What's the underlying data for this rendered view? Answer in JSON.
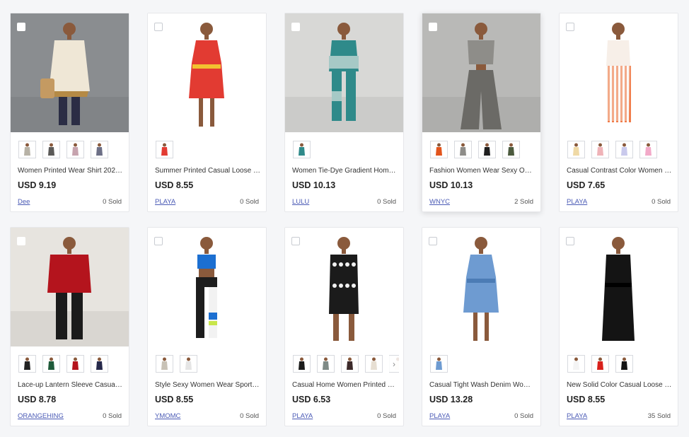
{
  "products": [
    {
      "title": "Women Printed Wear Shirt 202…",
      "price": "USD 9.19",
      "seller": "Dee",
      "sold": "0 Sold",
      "bg": "#8a8d90",
      "garment": "#efe7d6",
      "accent": "#b58a45",
      "style": "top",
      "thumbs": [
        "#b7b2a6",
        "#5b5a58",
        "#c6a3ae",
        "#6c6f86"
      ]
    },
    {
      "title": "Summer Printed Casual Loose …",
      "price": "USD 8.55",
      "seller": "PLAYA",
      "sold": "0 Sold",
      "bg": "#ffffff",
      "garment": "#e23b32",
      "accent": "#f2c230",
      "style": "dress",
      "thumbs": [
        "#e23b32"
      ]
    },
    {
      "title": "Women Tie-Dye Gradient Hom…",
      "price": "USD 10.13",
      "seller": "LULU",
      "sold": "0 Sold",
      "bg": "#d8d8d6",
      "garment": "#2f8a8a",
      "accent": "#a6c9c6",
      "style": "set",
      "thumbs": [
        "#2f8a8a"
      ]
    },
    {
      "title": "Fashion Women Wear Sexy One…",
      "price": "USD 10.13",
      "seller": "WNYC",
      "sold": "2 Sold",
      "bg": "#b9b9b7",
      "garment": "#8e8d89",
      "accent": "#6b6a66",
      "style": "wide",
      "thumbs": [
        "#e2541c",
        "#8e8d89",
        "#1f1f1f",
        "#4b5a3e"
      ]
    },
    {
      "title": "Casual Contrast Color Women …",
      "price": "USD 7.65",
      "seller": "PLAYA",
      "sold": "0 Sold",
      "bg": "#ffffff",
      "garment": "#f7efe8",
      "accent": "#f07c4a",
      "style": "striped",
      "thumbs": [
        "#efd9a5",
        "#efb3b8",
        "#c9c9ec",
        "#f2a9c8"
      ]
    },
    {
      "title": "Lace-up Lantern Sleeve Casual …",
      "price": "USD 8.78",
      "seller": "ORANGEHING",
      "sold": "0 Sold",
      "bg": "#e7e4df",
      "garment": "#b4141d",
      "accent": "#1b1b1b",
      "style": "top-pants",
      "thumbs": [
        "#222222",
        "#1f5a3a",
        "#b4141d",
        "#25284a"
      ]
    },
    {
      "title": "Style Sexy Women Wear Sports …",
      "price": "USD 8.55",
      "seller": "YMOMC",
      "sold": "0 Sold",
      "bg": "#ffffff",
      "garment": "#1d1d1d",
      "accent": "#1c6fd1",
      "style": "sport",
      "thumbs": [
        "#c8c2b6",
        "#e5e5e5"
      ]
    },
    {
      "title": "Casual Home Women Printed …",
      "price": "USD 6.53",
      "seller": "PLAYA",
      "sold": "0 Sold",
      "bg": "#ffffff",
      "garment": "#1b1b1b",
      "accent": "#f0f0f0",
      "style": "romper",
      "thumbs": [
        "#1b1b1b",
        "#7e8a86",
        "#3c2a2a",
        "#e7dfd3",
        "#f5ede0"
      ]
    },
    {
      "title": "Casual Tight Wash Denim Wom…",
      "price": "USD 13.28",
      "seller": "PLAYA",
      "sold": "0 Sold",
      "bg": "#ffffff",
      "garment": "#6e9bd1",
      "accent": "#4c7cb5",
      "style": "dress",
      "thumbs": [
        "#6e9bd1"
      ]
    },
    {
      "title": "New Solid Color Casual Loose …",
      "price": "USD 8.55",
      "seller": "PLAYA",
      "sold": "35 Sold",
      "bg": "#ffffff",
      "garment": "#141414",
      "accent": "#141414",
      "style": "maxi",
      "thumbs": [
        "#f4f4f4",
        "#d8211c",
        "#141414"
      ]
    }
  ]
}
